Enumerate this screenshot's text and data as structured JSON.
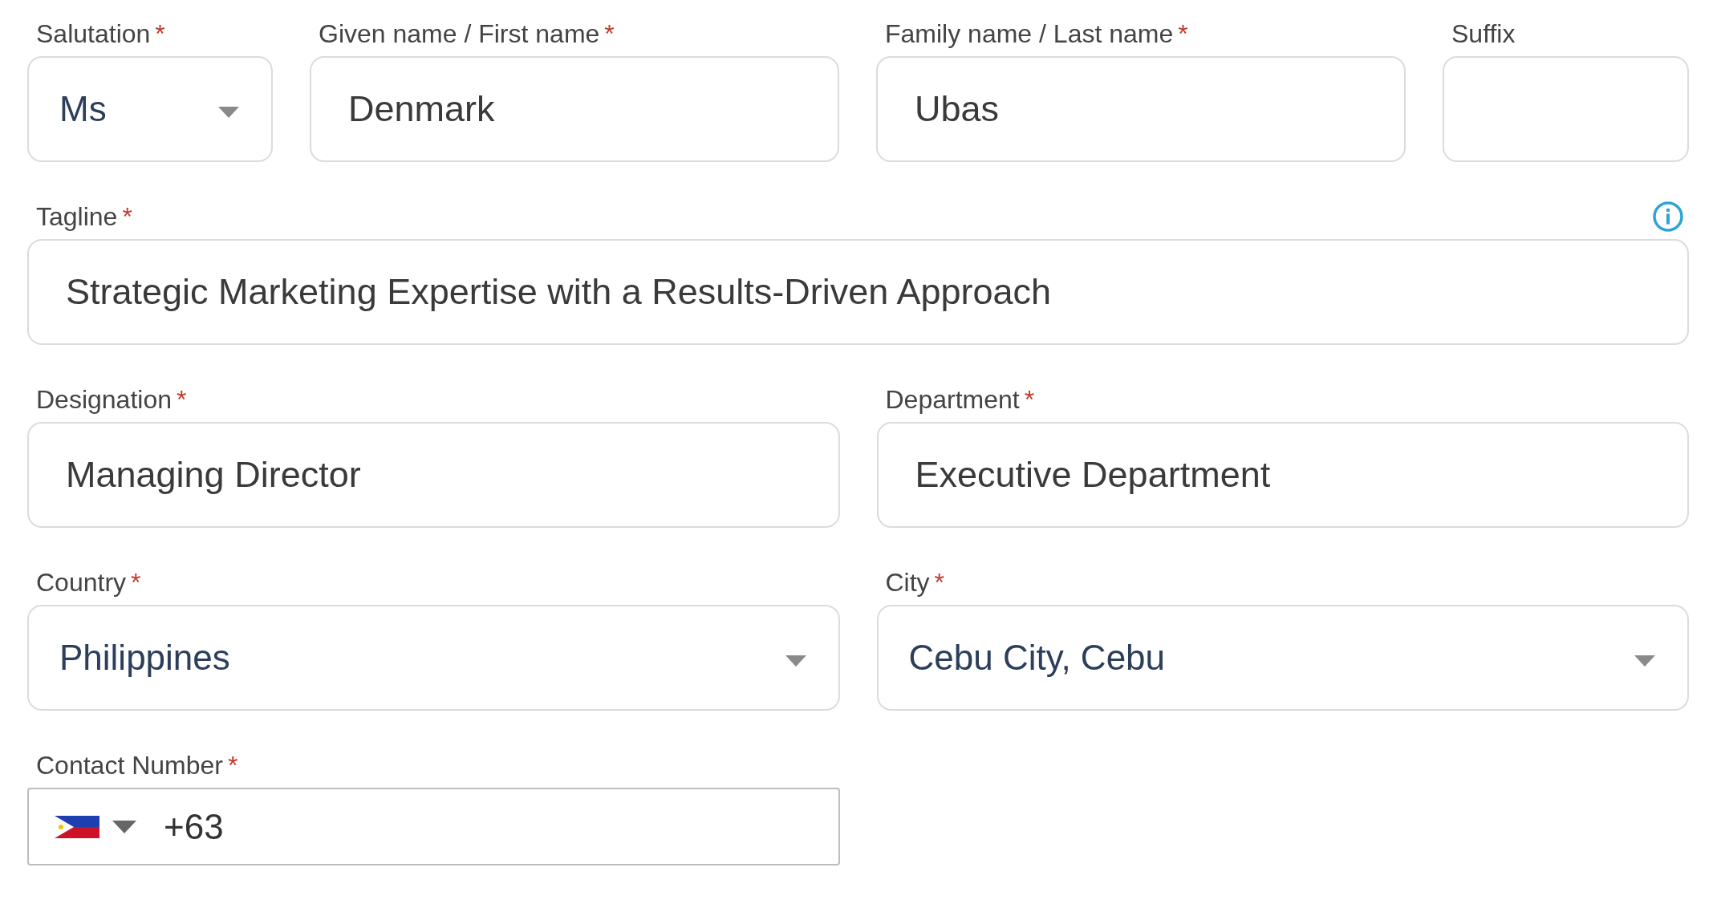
{
  "name_row": [
    {
      "label": "Salutation",
      "marker": "*",
      "kind": "select",
      "value": "Ms"
    },
    {
      "label": "Given name / First name",
      "marker": "*",
      "kind": "text",
      "value": "Denmark"
    },
    {
      "label": "Family name / Last name",
      "marker": "*",
      "kind": "text",
      "value": "Ubas"
    },
    {
      "label": "Suffix",
      "kind": "text"
    }
  ],
  "tagline": {
    "label": "Tagline",
    "marker": "*",
    "kind": "text",
    "value": "Strategic Marketing Expertise with a Results-Driven Approach"
  },
  "rows": [
    [
      {
        "label": "Designation",
        "marker": "*",
        "kind": "text",
        "value": "Managing Director"
      },
      {
        "label": "Department",
        "marker": "*",
        "kind": "text",
        "value": "Executive Department"
      }
    ],
    [
      {
        "label": "Country",
        "marker": "*",
        "kind": "select",
        "value": "Philippines"
      },
      {
        "label": "City",
        "marker": "*",
        "kind": "select",
        "value": "Cebu City, Cebu"
      }
    ]
  ],
  "contact": {
    "label": "Contact Number",
    "marker": "*",
    "kind": "phone",
    "value": "+63"
  }
}
